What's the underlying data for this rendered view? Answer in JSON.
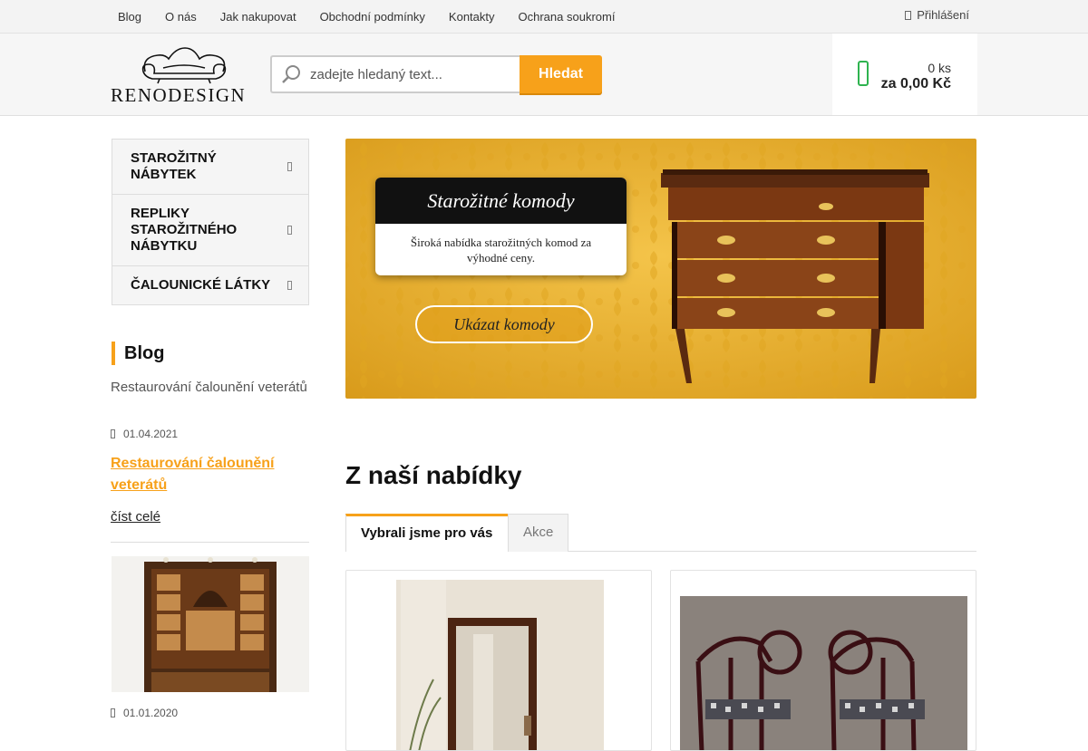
{
  "topnav": {
    "links": [
      "Blog",
      "O nás",
      "Jak nakupovat",
      "Obchodní podmínky",
      "Kontakty",
      "Ochrana soukromí"
    ],
    "login_label": "Přihlášení",
    "login_icon": "lock-icon"
  },
  "header": {
    "logo_text": "RENODESIGN",
    "search_placeholder": "zadejte hledaný text...",
    "search_button": "Hledat",
    "cart_count": "0 ks",
    "cart_total": "za 0,00 Kč"
  },
  "sidebar": {
    "categories": [
      "STAROŽITNÝ NÁBYTEK",
      "REPLIKY STAROŽITNÉHO NÁBYTKU",
      "ČALOUNICKÉ LÁTKY"
    ],
    "blog_title": "Blog",
    "posts": [
      {
        "image_alt": "Restaurování čalounění veterátů",
        "date": "01.04.2021",
        "title": "Restaurování čalounění veterátů",
        "read_more": "číst celé"
      },
      {
        "date": "01.01.2020"
      }
    ]
  },
  "banner": {
    "title": "Starožitné komody",
    "subtitle": "Široká nabídka starožitných komod za výhodné ceny.",
    "button": "Ukázat komody"
  },
  "offers": {
    "title": "Z naší nabídky",
    "tabs": [
      "Vybrali jsme pro vás",
      "Akce"
    ]
  },
  "colors": {
    "accent": "#f7a11a",
    "cart_green": "#2eb34f"
  }
}
